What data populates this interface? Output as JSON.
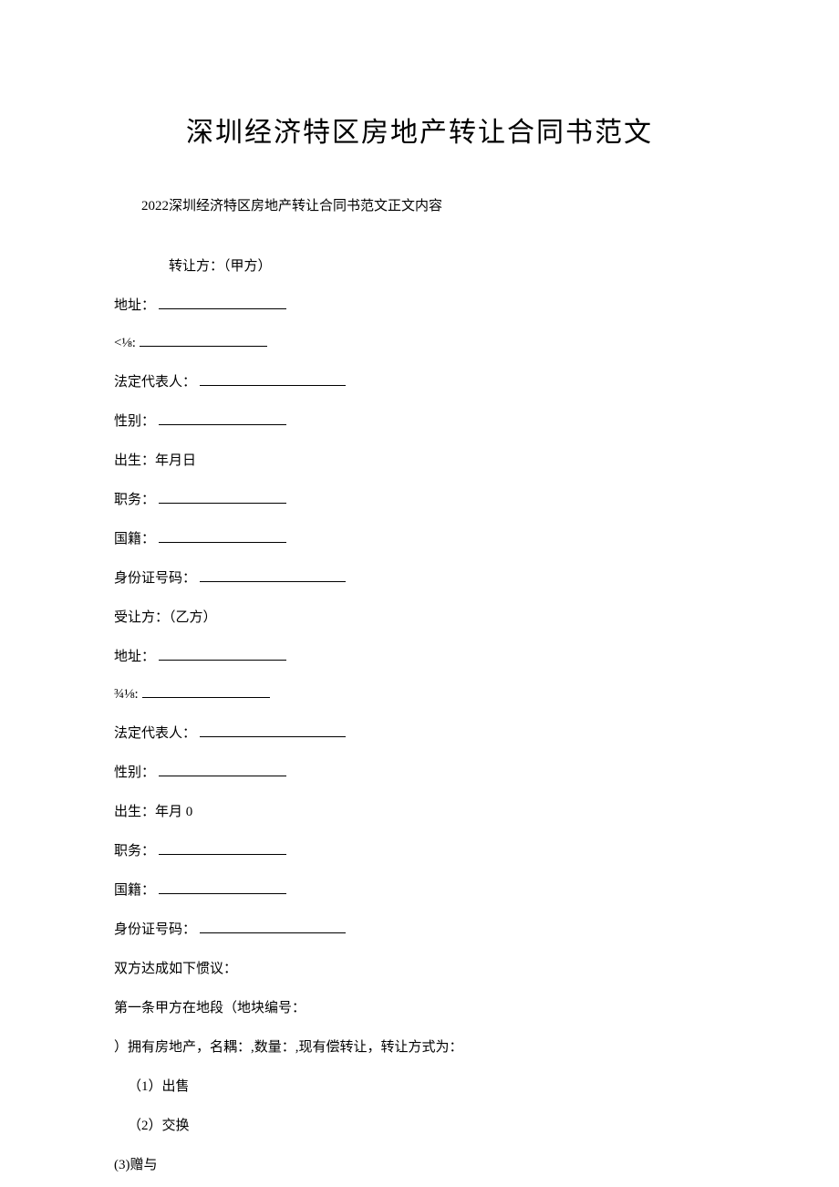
{
  "title": "深圳经济特区房地产转让合同书范文",
  "subtitle": "2022深圳经济特区房地产转让合同书范文正文内容",
  "transferor_header": "转让方：（甲方）",
  "party_a": {
    "address_label": "地址：",
    "code_label": "<⅛:",
    "legal_rep_label": "法定代表人：",
    "gender_label": "性别：",
    "birth_label": "出生：年月日",
    "position_label": "职务：",
    "nationality_label": "国籍：",
    "id_label": "身份证号码："
  },
  "transferee_header": "受让方：（乙方）",
  "party_b": {
    "address_label": "地址：",
    "code_label": "¾⅛:",
    "legal_rep_label": "法定代表人：",
    "gender_label": "性别：",
    "birth_label": "出生：年月 0",
    "position_label": "职务：",
    "nationality_label": "国籍：",
    "id_label": "身份证号码："
  },
  "agreement_header": "双方达成如下惯议：",
  "article_1_line1": "第一条甲方在地段（地块编号：",
  "article_1_line2": "）拥有房地产，名耦：,数量：,现有偿转让，转让方式为：",
  "method_1": "（1）出售",
  "method_2": "（2）交换",
  "method_3": "(3)赠与"
}
